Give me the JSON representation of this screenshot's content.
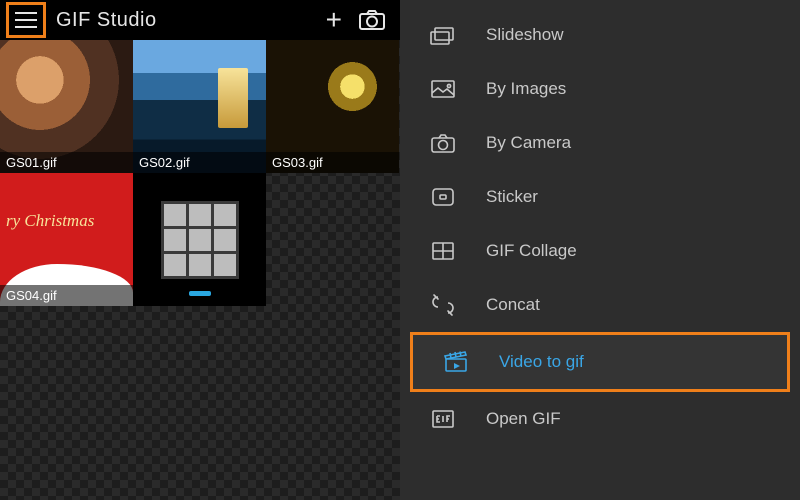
{
  "header": {
    "title": "GIF Studio"
  },
  "thumbs": [
    {
      "caption": "GS01.gif"
    },
    {
      "caption": "GS02.gif"
    },
    {
      "caption": "GS03.gif"
    },
    {
      "caption": "GS04.gif",
      "overlay_text": "ry Christmas"
    },
    {
      "caption": ""
    }
  ],
  "menu": {
    "items": [
      {
        "label": "Slideshow",
        "icon": "stack-icon"
      },
      {
        "label": "By Images",
        "icon": "image-icon"
      },
      {
        "label": "By Camera",
        "icon": "camera-icon"
      },
      {
        "label": "Sticker",
        "icon": "sticker-icon"
      },
      {
        "label": "GIF Collage",
        "icon": "collage-icon"
      },
      {
        "label": "Concat",
        "icon": "concat-icon"
      },
      {
        "label": "Video to gif",
        "icon": "clapper-icon",
        "selected": true
      },
      {
        "label": "Open GIF",
        "icon": "open-gif-icon"
      }
    ]
  },
  "colors": {
    "accent_highlight": "#ef7f1a",
    "accent_selected": "#3aa6e6",
    "panel_bg": "#2d2d2d"
  }
}
